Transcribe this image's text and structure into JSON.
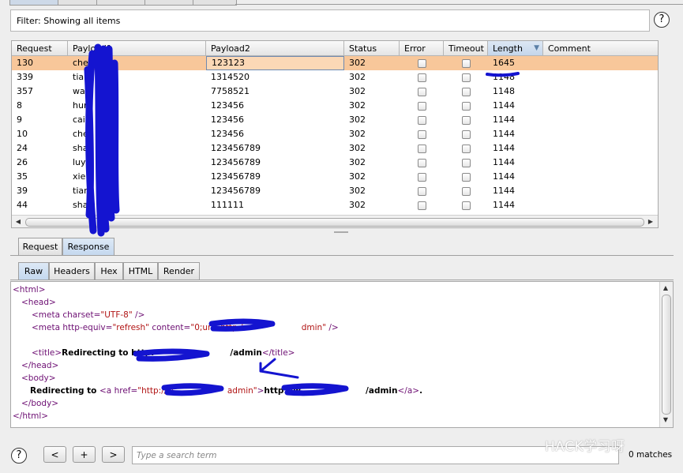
{
  "filter": {
    "text": "Filter:  Showing all items"
  },
  "columns": [
    {
      "label": "Request"
    },
    {
      "label": "Payload1"
    },
    {
      "label": "Payload2"
    },
    {
      "label": "Status"
    },
    {
      "label": "Error"
    },
    {
      "label": "Timeout"
    },
    {
      "label": "Length",
      "sorted": "descending"
    },
    {
      "label": "Comment"
    }
  ],
  "rows": [
    {
      "request": "130",
      "payload1": "che",
      "payload2": "123123",
      "status": "302",
      "error": false,
      "timeout": false,
      "length": "1645",
      "selected": true
    },
    {
      "request": "339",
      "payload1": "tian",
      "payload2": "1314520",
      "status": "302",
      "error": false,
      "timeout": false,
      "length": "1148"
    },
    {
      "request": "357",
      "payload1": "wa g",
      "payload2": "7758521",
      "status": "302",
      "error": false,
      "timeout": false,
      "length": "1148"
    },
    {
      "request": "8",
      "payload1": "hum",
      "payload2": "123456",
      "status": "302",
      "error": false,
      "timeout": false,
      "length": "1144"
    },
    {
      "request": "9",
      "payload1": "cailu",
      "payload2": "123456",
      "status": "302",
      "error": false,
      "timeout": false,
      "length": "1144"
    },
    {
      "request": "10",
      "payload1": "che",
      "payload2": "123456",
      "status": "302",
      "error": false,
      "timeout": false,
      "length": "1144"
    },
    {
      "request": "24",
      "payload1": "sha",
      "payload2": "123456789",
      "status": "302",
      "error": false,
      "timeout": false,
      "length": "1144"
    },
    {
      "request": "26",
      "payload1": "luy",
      "payload2": "123456789",
      "status": "302",
      "error": false,
      "timeout": false,
      "length": "1144"
    },
    {
      "request": "35",
      "payload1": "xie",
      "payload2": "123456789",
      "status": "302",
      "error": false,
      "timeout": false,
      "length": "1144"
    },
    {
      "request": "39",
      "payload1": "tian",
      "payload2": "123456789",
      "status": "302",
      "error": false,
      "timeout": false,
      "length": "1144"
    },
    {
      "request": "44",
      "payload1": "sha",
      "payload2": "111111",
      "status": "302",
      "error": false,
      "timeout": false,
      "length": "1144"
    }
  ],
  "rr_tabs": [
    {
      "label": "Request"
    },
    {
      "label": "Response",
      "active": true
    }
  ],
  "view_tabs": [
    {
      "label": "Raw",
      "active": true
    },
    {
      "label": "Headers"
    },
    {
      "label": "Hex"
    },
    {
      "label": "HTML"
    },
    {
      "label": "Render"
    }
  ],
  "code": {
    "html_open": "<html>",
    "head_open": "<head>",
    "meta_charset_tag": "<meta",
    "meta_charset_attr": " charset=",
    "meta_charset_val": "\"UTF-8\"",
    "meta_charset_end": " />",
    "meta_refresh_tag": "<meta",
    "meta_refresh_attr1": " http-equiv=",
    "meta_refresh_val1": "\"refresh\"",
    "meta_refresh_attr2": " content=",
    "meta_refresh_val2": "\"0;url=http:/",
    "meta_refresh_val3": "dmin\"",
    "meta_refresh_end": " />",
    "title_open": "<title>",
    "title_text_a": "Redirecting to http:",
    "title_text_b": "/admin",
    "title_close": "</title>",
    "head_close": "</head>",
    "body_open": "<body>",
    "body_text": "Redirecting to ",
    "a_open": "<a",
    "a_attr": " href=",
    "a_val_a": "\"http://w",
    "a_val_b": "admin\"",
    "a_gt": ">",
    "a_text_a": "http://w",
    "a_text_b": "/admin",
    "a_close": "</a>",
    "a_period": ".",
    "body_close": "</body>",
    "html_close": "</html>"
  },
  "search": {
    "placeholder": "Type a search term",
    "matches": "0 matches"
  },
  "nav": {
    "prev": "<",
    "add": "+",
    "next": ">",
    "help": "?"
  },
  "watermark": "HACK学习呀",
  "colors": {
    "selected_row": "#f8c79a",
    "annotation_ink": "#1414d0",
    "tag": "#6d0f73",
    "attr_value": "#b11414"
  }
}
